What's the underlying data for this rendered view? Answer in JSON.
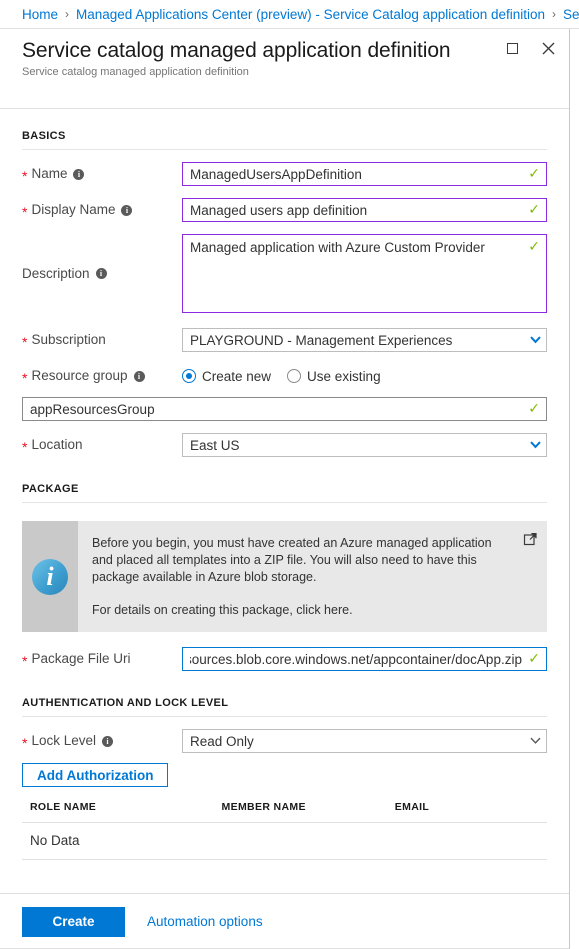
{
  "breadcrumb": {
    "items": [
      {
        "label": "Home"
      },
      {
        "label": "Managed Applications Center (preview) - Service Catalog application definition"
      },
      {
        "label": "Serv"
      }
    ],
    "separator": "›"
  },
  "blade": {
    "title": "Service catalog managed application definition",
    "subtitle": "Service catalog managed application definition",
    "maximize_label": "Maximize",
    "close_label": "Close"
  },
  "sections": {
    "basics": {
      "header": "BASICS",
      "name": {
        "label": "Name",
        "required": "*",
        "value": "ManagedUsersAppDefinition",
        "placeholder": "",
        "valid": "✓"
      },
      "display_name": {
        "label": "Display Name",
        "required": "*",
        "value": "Managed users app definition",
        "placeholder": "",
        "valid": "✓"
      },
      "description": {
        "label": "Description",
        "required": "",
        "value": "Managed application with Azure Custom Provider",
        "placeholder": "",
        "valid": "✓"
      },
      "subscription": {
        "label": "Subscription",
        "required": "*",
        "value": "PLAYGROUND - Management Experiences"
      },
      "resource_group": {
        "label": "Resource group",
        "required": "*",
        "options": [
          {
            "label": "Create new",
            "selected": true
          },
          {
            "label": "Use existing",
            "selected": false
          }
        ],
        "value": "appResourcesGroup",
        "valid": "✓"
      },
      "location": {
        "label": "Location",
        "required": "*",
        "value": "East US"
      }
    },
    "package": {
      "header": "PACKAGE",
      "callout": {
        "paragraph1": "Before you begin, you must have created an Azure managed application and placed all templates into a ZIP file. You will also need to have this package available in Azure blob storage.",
        "paragraph2": "For details on creating this package, click here.",
        "icon": "info-icon",
        "popout": "open-in-new-window-icon"
      },
      "package_file_uri": {
        "label": "Package File Uri",
        "required": "*",
        "value": "resources.blob.core.windows.net/appcontainer/docApp.zip",
        "valid": "✓"
      }
    },
    "auth": {
      "header": "AUTHENTICATION AND LOCK LEVEL",
      "lock_level": {
        "label": "Lock Level",
        "required": "*",
        "value": "Read Only"
      },
      "add_authorization_label": "Add Authorization",
      "table": {
        "columns": [
          "ROLE NAME",
          "MEMBER NAME",
          "EMAIL"
        ],
        "empty_text": "No Data",
        "rows": []
      }
    }
  },
  "footer": {
    "create_label": "Create",
    "automation_label": "Automation options"
  },
  "colors": {
    "accent": "#0078d4",
    "valid_border": "#8a2be2",
    "valid_check": "#7fba00",
    "required_star": "#e81123"
  }
}
